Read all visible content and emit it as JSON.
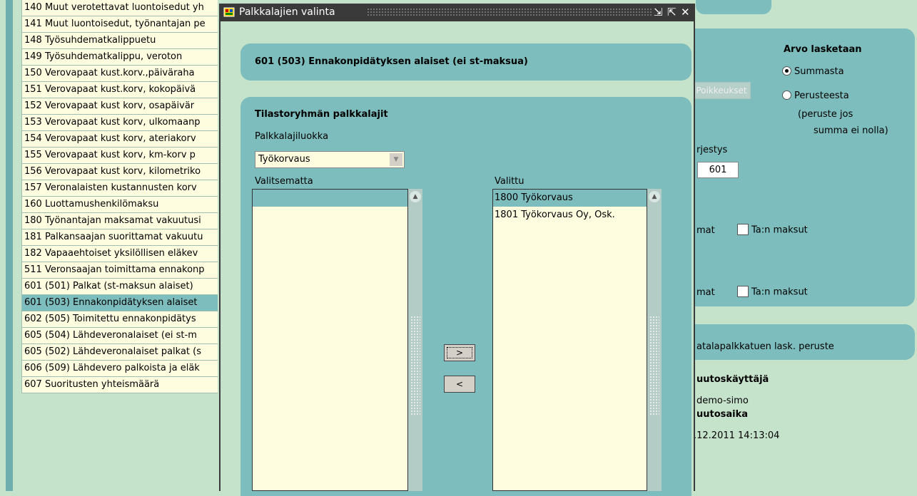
{
  "left_list": {
    "items": [
      "140 Muut verotettavat luontoisedut yh",
      "141 Muut luontoisedut, työnantajan pe",
      "148 Työsuhdematkalippuetu",
      "149 Työsuhdematkalippu, veroton",
      "150 Verovapaat kust.korv.,päiväraha",
      "151 Verovapaat kust.korv, kokopäivä",
      "152 Verovapaat kust korv, osapäivär",
      "153 Verovapaat kust korv, ulkomaanp",
      "154 Verovapaat kust korv, ateriakorv",
      "155 Verovapaat kust korv, km-korv p",
      "156 Verovapaat kust korv, kilometriko",
      "157 Veronalaisten kustannusten korv",
      "160 Luottamushenkilömaksu",
      "180 Työnantajan maksamat vakuutusi",
      "181 Palkansaajan suorittamat vakuutu",
      "182 Vapaaehtoiset yksilöllisen eläkev",
      "511 Veronsaajan toimittama ennakonp",
      "601 (501) Palkat (st-maksun alaiset)",
      "601 (503) Ennakonpidätyksen alaiset",
      "602 (505) Toimitettu ennakonpidätys",
      "605 (504) Lähdeveronalaiset (ei st-m",
      "605 (502) Lähdeveronalaiset palkat (s",
      "606 (509) Lähdevero palkoista ja eläk",
      "607 Suoritusten yhteismäärä"
    ],
    "selected_index": 18
  },
  "dialog": {
    "title": "Palkkalajien valinta",
    "header": "601 (503) Ennakonpidätyksen alaiset (ei st-maksua)",
    "section_title": "Tilastoryhmän palkkalajit",
    "category_label": "Palkkalajiluokka",
    "category_value": "Työkorvaus",
    "unselected_label": "Valitsematta",
    "selected_label": "Valittu",
    "unselected_items": [
      ""
    ],
    "selected_items": [
      "1800 Työkorvaus",
      "1801 Työkorvaus Oy, Osk."
    ],
    "add_button": ">",
    "remove_button": "<"
  },
  "background_panel": {
    "exceptions_button": "Poikkeukset",
    "calc_title": "Arvo lasketaan",
    "radio_sum": "Summasta",
    "radio_base": "Perusteesta",
    "base_note_1": "(peruste jos",
    "base_note_2": "summa ei nolla)",
    "order_label": "rjestys",
    "order_value": "601",
    "row1_label": "mat",
    "row1_check": "Ta:n maksut",
    "row2_label": "mat",
    "row2_check": "Ta:n maksut",
    "low_pay_label": "atalapalkkatuen lask. peruste",
    "changed_by_label": "uutoskäyttäjä",
    "changed_by_value": "demo-simo",
    "changed_at_label": "uutosaika",
    "changed_at_value": ".12.2011 14:13:04"
  }
}
